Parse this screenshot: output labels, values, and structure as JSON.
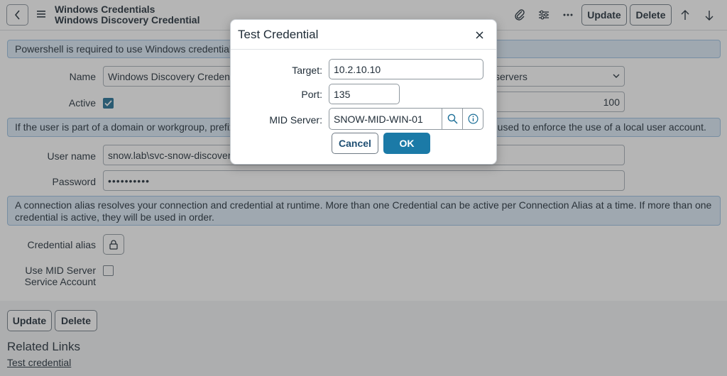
{
  "header": {
    "title_line1": "Windows Credentials",
    "title_line2": "Windows Discovery Credential",
    "buttons": {
      "update": "Update",
      "delete": "Delete"
    },
    "icons": [
      "back-chevron-icon",
      "hamburger-icon",
      "paperclip-icon",
      "sliders-icon",
      "more-icon",
      "arrow-up-icon",
      "arrow-down-icon"
    ]
  },
  "form": {
    "banner_powershell": "Powershell is required to use Windows credentials.",
    "name_label": "Name",
    "name_value": "Windows Discovery Credentia",
    "applies_to_value": "servers",
    "active_label": "Active",
    "order_value": "100",
    "banner_domain_left": "If the user is part of a domain or workgroup, prefix th",
    "banner_domain_right": "e used to enforce the use of a local user account.",
    "username_label": "User name",
    "username_value": "snow.lab\\svc-snow-discovery",
    "password_label": "Password",
    "password_value": "••••••••••",
    "banner_alias": "A connection alias resolves your connection and credential at runtime. More than one Credential can be active per Connection Alias at a time. If more than one credential is active, they will be used in order.",
    "credential_alias_label": "Credential alias",
    "use_mid_label_1": "Use MID Server",
    "use_mid_label_2": "Service Account"
  },
  "footer": {
    "update": "Update",
    "delete": "Delete",
    "related_links_title": "Related Links",
    "test_credential_link": "Test credential"
  },
  "modal": {
    "title": "Test Credential",
    "target_label": "Target:",
    "target_value": "10.2.10.10",
    "port_label": "Port:",
    "port_value": "135",
    "mid_label": "MID Server:",
    "mid_value": "SNOW-MID-WIN-01",
    "cancel": "Cancel",
    "ok": "OK"
  },
  "colors": {
    "banner_bg": "#dbeaf7",
    "primary": "#1b7aa7",
    "checkbox_checked": "#1f6e94"
  }
}
